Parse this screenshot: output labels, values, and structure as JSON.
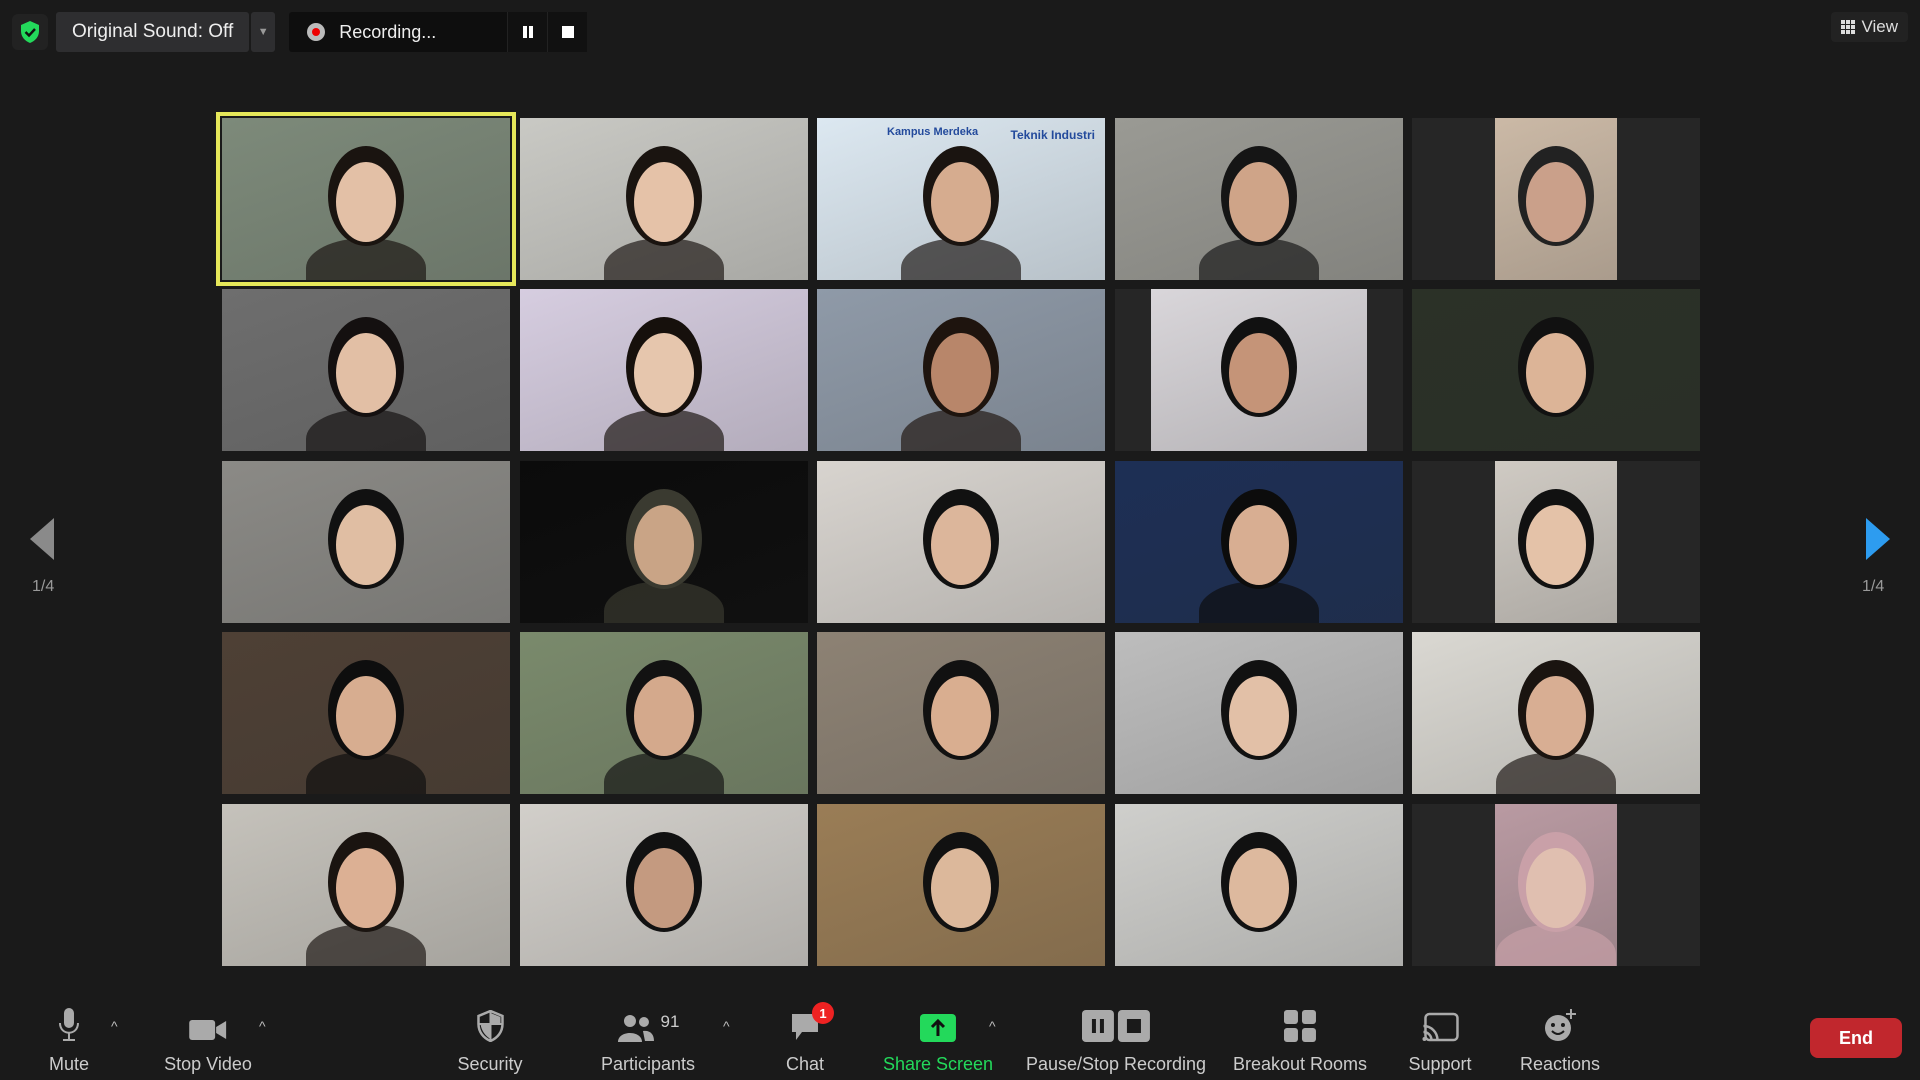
{
  "top": {
    "original_sound": "Original Sound: Off",
    "recording": "Recording...",
    "view": "View"
  },
  "pager": {
    "left": "1/4",
    "right": "1/4"
  },
  "toolbar": {
    "mute": "Mute",
    "stop_video": "Stop Video",
    "security": "Security",
    "participants": "Participants",
    "participant_count": "91",
    "chat": "Chat",
    "chat_badge": "1",
    "share_screen": "Share Screen",
    "pause_stop_recording": "Pause/Stop Recording",
    "breakout_rooms": "Breakout Rooms",
    "support": "Support",
    "reactions": "Reactions",
    "end": "End"
  },
  "tile_banner": {
    "brand": "Kampus Merdeka",
    "dept": "Teknik Industri"
  },
  "colors": {
    "accent_green": "#23d95b",
    "active_speaker": "#e6e85a",
    "end_red": "#c1272d",
    "arrow_blue": "#2d9cf0"
  },
  "tiles": [
    {
      "bg": "#7d8a7a",
      "skin": "#e3c0a6",
      "hair": "#1a1410"
    },
    {
      "bg": "#c9c9c4",
      "skin": "#e5c2a8",
      "hair": "#1a1410"
    },
    {
      "bg": "#dce8f1",
      "skin": "#d6ac8f",
      "hair": "#1a1410"
    },
    {
      "bg": "#9a9a94",
      "skin": "#cfa488",
      "hair": "#151515"
    },
    {
      "bg": "#cbb9a6",
      "skin": "#caa08a",
      "hair": "#222"
    },
    {
      "bg": "#6e6e6e",
      "skin": "#e2bfa5",
      "hair": "#141010"
    },
    {
      "bg": "#d6cde0",
      "skin": "#e6c6ad",
      "hair": "#16100c"
    },
    {
      "bg": "#8f9aa8",
      "skin": "#b8866a",
      "hair": "#1e140e"
    },
    {
      "bg": "#d9d6da",
      "skin": "#c59478",
      "hair": "#111"
    },
    {
      "bg": "#2b3127",
      "skin": "#dcb497",
      "hair": "#111"
    },
    {
      "bg": "#8b8a86",
      "skin": "#e0bea3",
      "hair": "#111"
    },
    {
      "bg": "#0b0b0b",
      "skin": "#c9a486",
      "hair": "#3a3a30"
    },
    {
      "bg": "#d8d4cf",
      "skin": "#dcb69b",
      "hair": "#111"
    },
    {
      "bg": "#1d2f55",
      "skin": "#d8ae92",
      "hair": "#0c0c0c"
    },
    {
      "bg": "#cfcac3",
      "skin": "#e4c2a8",
      "hair": "#111"
    },
    {
      "bg": "#4e4035",
      "skin": "#d7ad90",
      "hair": "#0e0e0e"
    },
    {
      "bg": "#7a8a6c",
      "skin": "#d4a98c",
      "hair": "#121212"
    },
    {
      "bg": "#8d8274",
      "skin": "#d9ae90",
      "hair": "#111"
    },
    {
      "bg": "#bdbdbd",
      "skin": "#e2c0a7",
      "hair": "#111"
    },
    {
      "bg": "#dad8d2",
      "skin": "#d8ae93",
      "hair": "#1a1410"
    },
    {
      "bg": "#c5c2bb",
      "skin": "#dcb094",
      "hair": "#1a1410"
    },
    {
      "bg": "#d2cfca",
      "skin": "#c49a80",
      "hair": "#111"
    },
    {
      "bg": "#9a7d56",
      "skin": "#dcb89b",
      "hair": "#111"
    },
    {
      "bg": "#cfcfcc",
      "skin": "#ddb99e",
      "hair": "#111"
    },
    {
      "bg": "#b99aa2",
      "skin": "#e0bfb0",
      "hair": "#c9a0a8"
    }
  ]
}
